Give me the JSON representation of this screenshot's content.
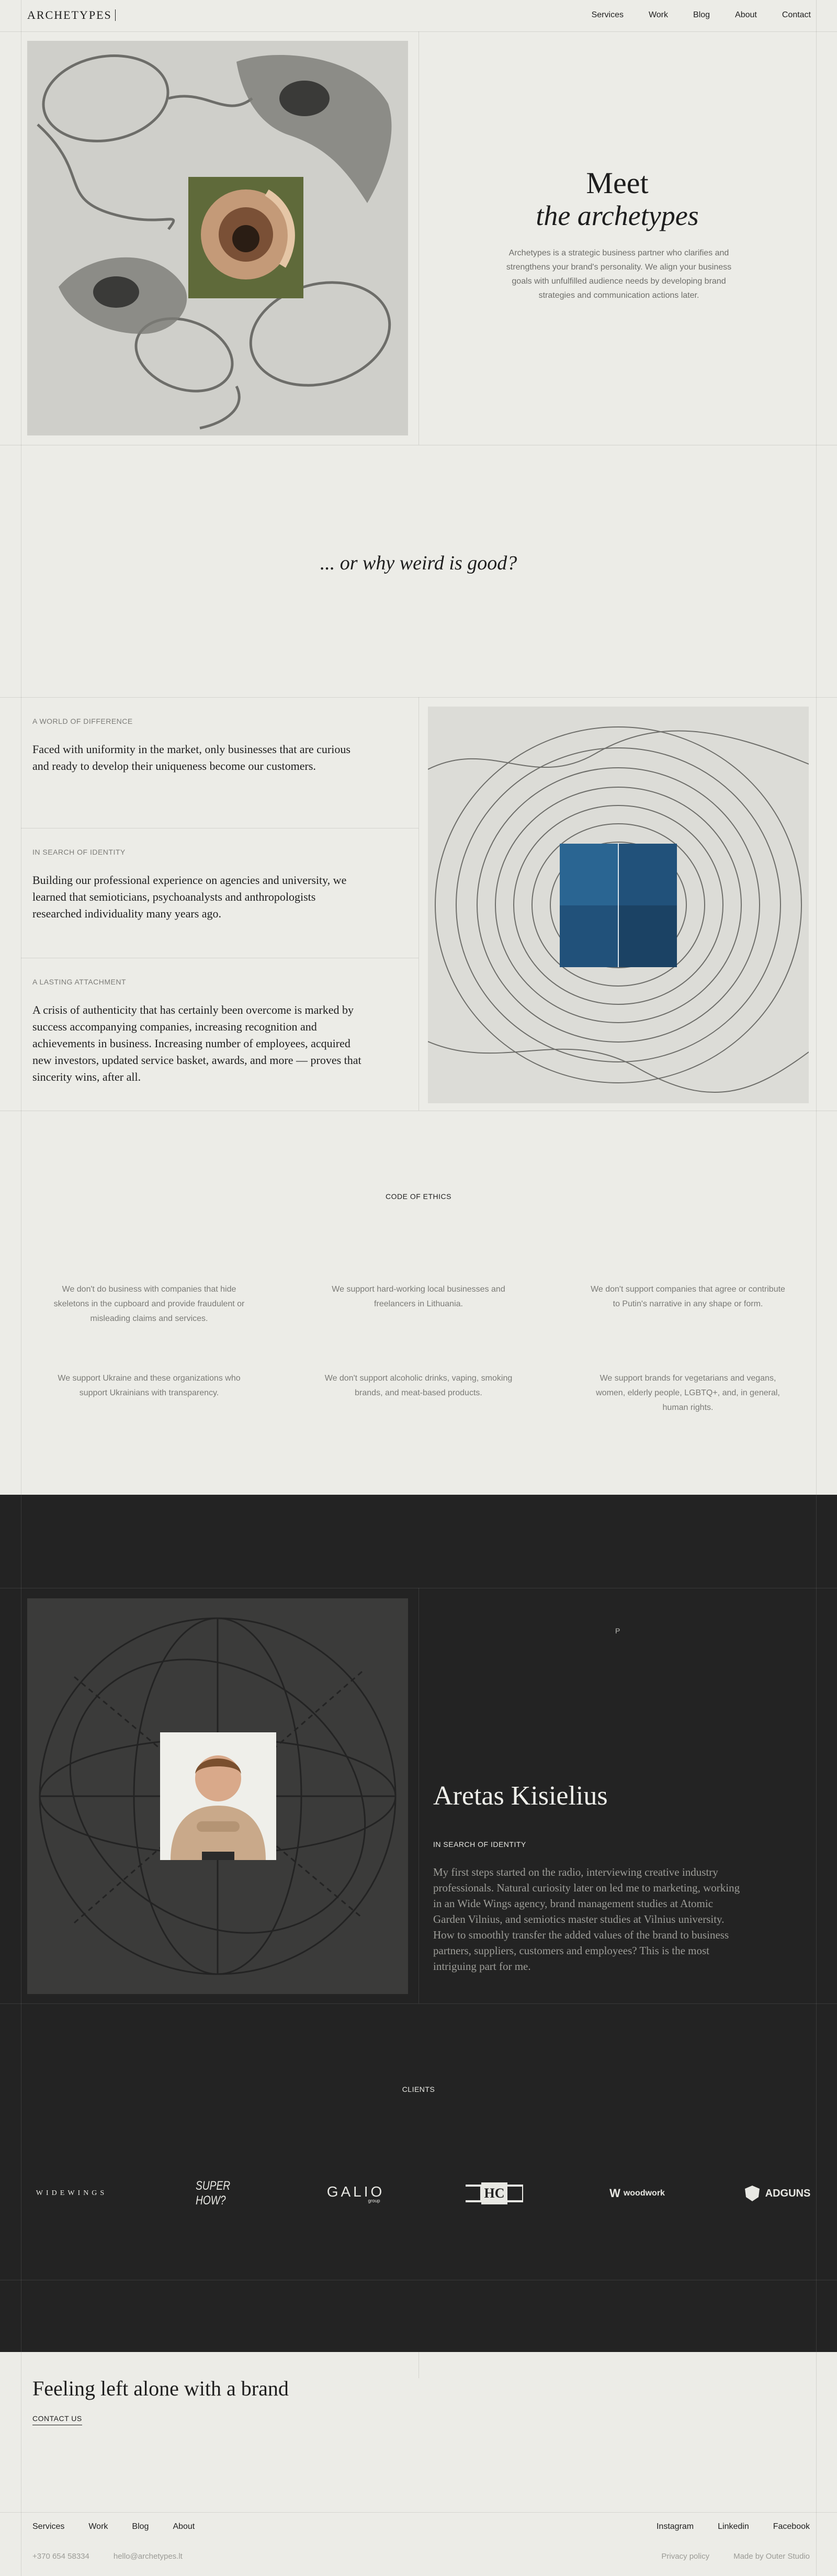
{
  "header": {
    "logo": "ARCHETYPES",
    "nav": [
      "Services",
      "Work",
      "Blog",
      "About",
      "Contact"
    ]
  },
  "hero": {
    "title_line1": "Meet",
    "title_line2": "the archetypes",
    "description": "Archetypes is a strategic business partner who clarifies and strengthens your brand's personality. We align your business goals with unfulfilled audience needs by developing brand strategies and communication actions later."
  },
  "weird": "... or why weird is good?",
  "blocks": [
    {
      "label": "A WORLD OF DIFFERENCE",
      "text": "Faced with uniformity in the market, only businesses that are curious and ready to develop their uniqueness become our customers."
    },
    {
      "label": "IN SEARCH OF IDENTITY",
      "text": "Building our professional experience on agencies and university, we learned that semioticians, psychoanalysts and anthropologists researched individuality many years ago."
    },
    {
      "label": "A LASTING ATTACHMENT",
      "text": "A crisis of authenticity that has certainly been overcome is marked by success accompanying companies, increasing recognition and achievements in business. Increasing number of employees, acquired new investors, updated service basket, awards, and more — proves that sincerity wins, after all."
    }
  ],
  "ethics": {
    "title": "CODE OF ETHICS",
    "items": [
      "We don't do business with companies that hide skeletons in the cupboard and provide fraudulent or misleading claims and services.",
      "We support hard-working local businesses and freelancers in Lithuania.",
      "We don't support companies that agree or contribute to Putin's narrative in any shape or form.",
      "We support Ukraine and these organizations who support Ukrainians with transparency.",
      "We don't support alcoholic drinks, vaping, smoking brands, and meat-based products.",
      "We support brands for vegetarians and vegans, women, elderly people, LGBTQ+, and, in general, human rights."
    ]
  },
  "person": {
    "mark": "P",
    "name": "Aretas Kisielius",
    "role": "IN SEARCH OF IDENTITY",
    "bio": "My first steps started on the radio, interviewing creative industry professionals. Natural curiosity later on led me to marketing, working in an Wide Wings agency, brand management studies at Atomic Garden Vilnius, and semiotics master studies at Vilnius university. How to smoothly transfer the added values of the brand to business partners, suppliers, customers and employees? This is the most intriguing part for me."
  },
  "clients": {
    "title": "CLIENTS",
    "logos": [
      "WIDEWINGS",
      "SUPER HOW?",
      "GALIO",
      "group",
      "HC",
      "woodwork",
      "ADGUNS"
    ]
  },
  "footer": {
    "cta": "Feeling left alone with a brand",
    "contact": "CONTACT US",
    "nav": [
      "Services",
      "Work",
      "Blog",
      "About"
    ],
    "social": [
      "Instagram",
      "Linkedin",
      "Facebook"
    ],
    "phone": "+370 654 58334",
    "email": "hello@archetypes.lt",
    "privacy": "Privacy policy",
    "made_by": "Made by Outer Studio"
  },
  "colors": {
    "background": "#ecece7",
    "dark_background": "#232323",
    "text": "#1e1e1e",
    "muted": "#7b7b77"
  }
}
